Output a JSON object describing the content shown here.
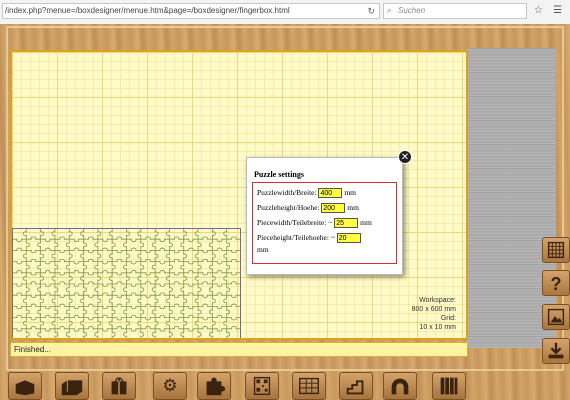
{
  "browser": {
    "url": "/index.php?menue=/boxdesigner/menue.htm&page=/boxdesigner/fingerbox.html",
    "search_placeholder": "Suchen"
  },
  "workspace": {
    "info_label": "Workspace:",
    "info_size": "800 x 600 mm",
    "info_grid_label": "Grid:",
    "info_grid": "10 x 10 mm"
  },
  "status": {
    "text": "Finished..."
  },
  "dialog": {
    "title": "Puzzle settings",
    "rows": [
      {
        "label": "Puzzlewidth/Breite:",
        "value": "400",
        "unit": "mm"
      },
      {
        "label": "Puzzleheight/Hoehe:",
        "value": "200",
        "unit": "mm"
      },
      {
        "label": "Piecewidth/Teilebreite: ~",
        "value": "25",
        "unit": "mm"
      },
      {
        "label": "Pieceheight/Teilehoehe: ~",
        "value": "20",
        "unit": "mm"
      }
    ]
  },
  "side_buttons": [
    "grid-icon",
    "help-icon",
    "image-icon",
    "download-icon"
  ],
  "toolbar": [
    "open-box-icon",
    "folded-box-icon",
    "gift-box-icon",
    "gear-icon",
    "puzzle-icon",
    "qr-code-icon",
    "table-icon",
    "stairs-icon",
    "arch-icon",
    "books-icon"
  ],
  "colors": {
    "workspace_bg": "#fffbc8",
    "workspace_border": "#e0a020",
    "puzzle_line": "#7a9a4a",
    "input_bg": "#ffff40",
    "dialog_border": "#cc3333"
  }
}
